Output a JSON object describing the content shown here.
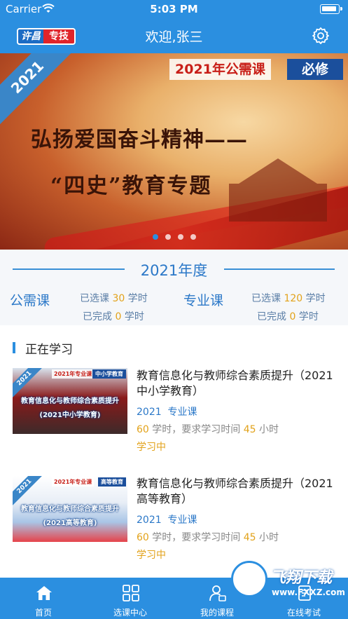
{
  "status_bar": {
    "carrier": "Carrier",
    "time": "5:03 PM"
  },
  "header": {
    "logo_part1": "许昌",
    "logo_part2": "专技",
    "title": "欢迎,张三"
  },
  "banner": {
    "corner_year": "2021",
    "tag_course": "2021年公需课",
    "tag_required": "必修",
    "headline_1": "弘扬爱国奋斗精神——",
    "headline_2": "“四史”教育专题",
    "slide_count": 4,
    "active_slide": 1
  },
  "year_summary": {
    "title": "2021年度",
    "public": {
      "label": "公需课",
      "selected_prefix": "已选课",
      "selected_value": "30",
      "completed_prefix": "已完成",
      "completed_value": "0",
      "unit": "学时"
    },
    "professional": {
      "label": "专业课",
      "selected_prefix": "已选课",
      "selected_value": "120",
      "completed_prefix": "已完成",
      "completed_value": "0",
      "unit": "学时"
    }
  },
  "learning": {
    "title": "正在学习",
    "courses": [
      {
        "title": "教育信息化与教师综合素质提升（2021中小学教育）",
        "year": "2021",
        "category": "专业课",
        "hours": "60",
        "hours_text": "学时，要求学习时间",
        "required": "45",
        "required_unit": "小时",
        "status": "学习中",
        "thumb_year": "2021",
        "thumb_tag1": "2021年专业课",
        "thumb_tag2": "中小学教育",
        "thumb_line1": "教育信息化与教师综合素质提升",
        "thumb_line2": "(2021中小学教育)"
      },
      {
        "title": "教育信息化与教师综合素质提升（2021高等教育）",
        "year": "2021",
        "category": "专业课",
        "hours": "60",
        "hours_text": "学时，要求学习时间",
        "required": "45",
        "required_unit": "小时",
        "status": "学习中",
        "thumb_year": "2021",
        "thumb_tag1": "2021年专业课",
        "thumb_tag2": "高等教育",
        "thumb_line1": "教育信息化与教师综合素质提升",
        "thumb_line2": "(2021高等教育)"
      }
    ]
  },
  "tabbar": {
    "tabs": [
      {
        "label": "首页",
        "icon": "home-icon"
      },
      {
        "label": "选课中心",
        "icon": "grid-icon"
      },
      {
        "label": "我的课程",
        "icon": "user-course-icon"
      },
      {
        "label": "在线考试",
        "icon": "exam-icon"
      }
    ]
  },
  "watermark": {
    "text": "飞翔下载",
    "url": "www.FXXZ.com"
  },
  "colors": {
    "primary": "#2b8fe0",
    "accent": "#e2a21a",
    "text_blue": "#2b78c8"
  }
}
